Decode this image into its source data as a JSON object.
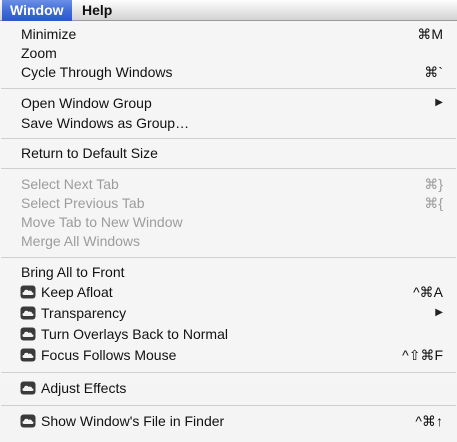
{
  "menubar": {
    "items": [
      {
        "label": "Window"
      },
      {
        "label": "Help"
      }
    ]
  },
  "menu": {
    "items": [
      {
        "label": "Minimize",
        "shortcut": "⌘M"
      },
      {
        "label": "Zoom",
        "shortcut": ""
      },
      {
        "label": "Cycle Through Windows",
        "shortcut": "⌘`"
      },
      {
        "label": "Open Window Group",
        "submenu": "▶"
      },
      {
        "label": "Save Windows as Group…"
      },
      {
        "label": "Return to Default Size"
      },
      {
        "label": "Select Next Tab",
        "shortcut": "⌘}",
        "disabled": true
      },
      {
        "label": "Select Previous Tab",
        "shortcut": "⌘{",
        "disabled": true
      },
      {
        "label": "Move Tab to New Window",
        "disabled": true
      },
      {
        "label": "Merge All Windows",
        "disabled": true
      },
      {
        "label": "Bring All to Front"
      },
      {
        "label": "Keep Afloat",
        "shortcut": "^⌘A",
        "icon": "cloud-icon"
      },
      {
        "label": "Transparency",
        "submenu": "▶",
        "icon": "cloud-icon"
      },
      {
        "label": "Turn Overlays Back to Normal",
        "icon": "cloud-icon"
      },
      {
        "label": "Focus Follows Mouse",
        "shortcut": "^⇧⌘F",
        "icon": "cloud-icon"
      },
      {
        "label": "Adjust Effects",
        "icon": "cloud-icon"
      },
      {
        "label": "Show Window's File in Finder",
        "shortcut": "^⌘↑",
        "icon": "cloud-icon"
      }
    ]
  },
  "colors": {
    "highlight": "#3f6ad8",
    "disabled_text": "#9c9c9c"
  }
}
